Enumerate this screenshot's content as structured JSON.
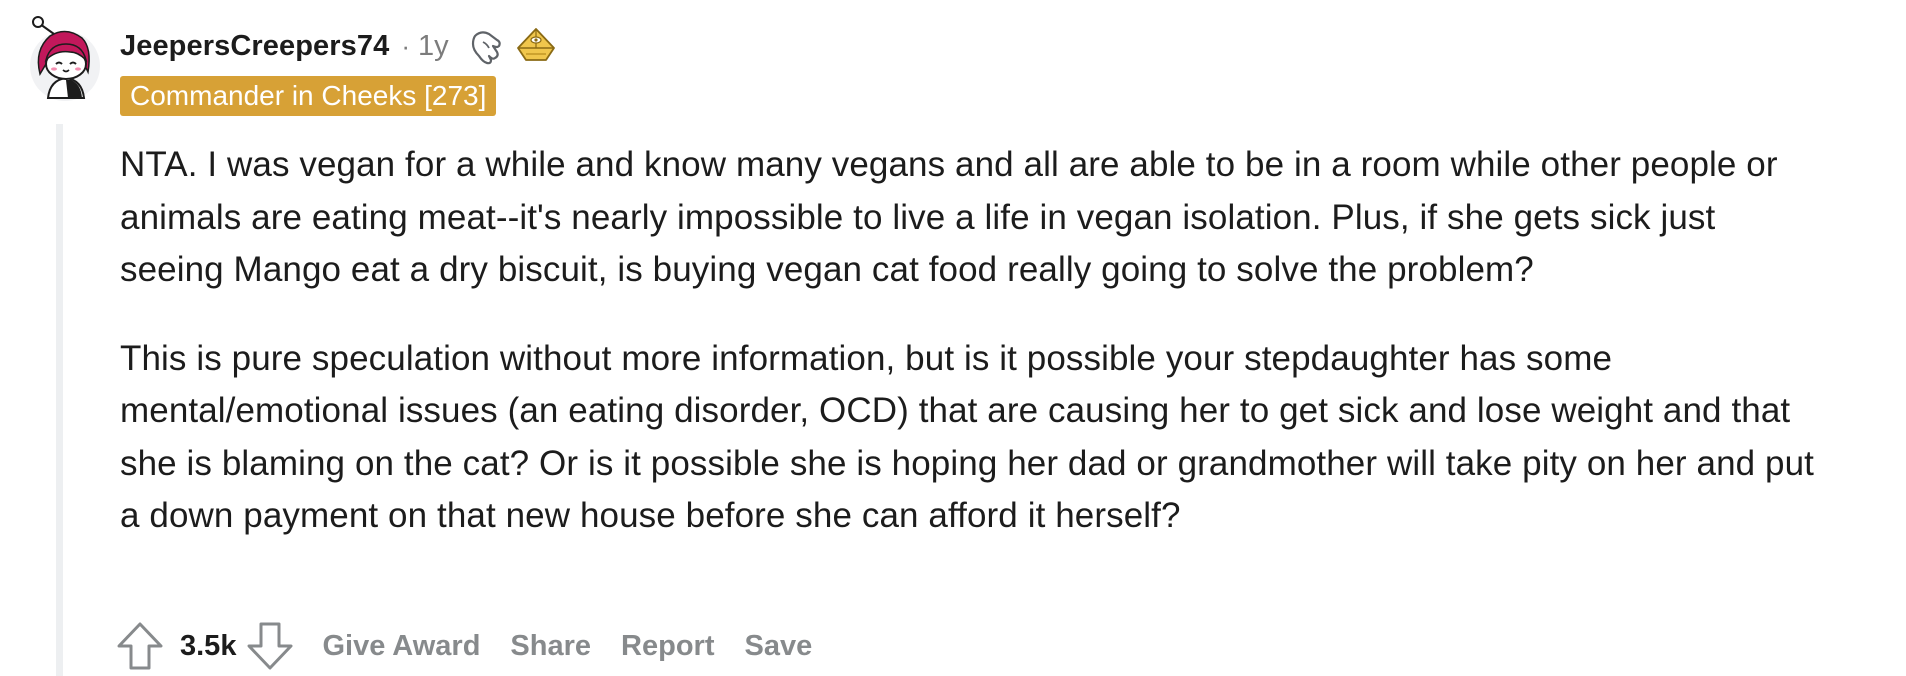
{
  "comment": {
    "username": "JeepersCreepers74",
    "separator": "·",
    "age": "1y",
    "awards": [
      "pointing-hand-award-icon",
      "gold-pyramid-award-icon"
    ],
    "flair": "Commander in Cheeks [273]",
    "paragraphs": [
      "NTA. I was vegan for a while and know many vegans and all are able to be in a room while other people or animals are eating meat--it's nearly impossible to live a life in vegan isolation. Plus, if she gets sick just seeing Mango eat a dry biscuit, is buying vegan cat food really going to solve the problem?",
      "This is pure speculation without more information, but is it possible your stepdaughter has some mental/emotional issues (an eating disorder, OCD) that are causing her to get sick and lose weight and that she is blaming on the cat? Or is it possible she is hoping her dad or grandmother will take pity on her and put a down payment on that new house before she can afford it herself?"
    ],
    "score": "3.5k",
    "actions": {
      "give_award": "Give Award",
      "share": "Share",
      "report": "Report",
      "save": "Save"
    }
  },
  "colors": {
    "flair_bg": "#d7a136",
    "flair_text": "#ffffff",
    "text": "#1c1c1c",
    "muted": "#7c7c7c",
    "action_text": "#878a8c",
    "thread_line": "#edeff1",
    "avatar_hair": "#c2185b"
  }
}
